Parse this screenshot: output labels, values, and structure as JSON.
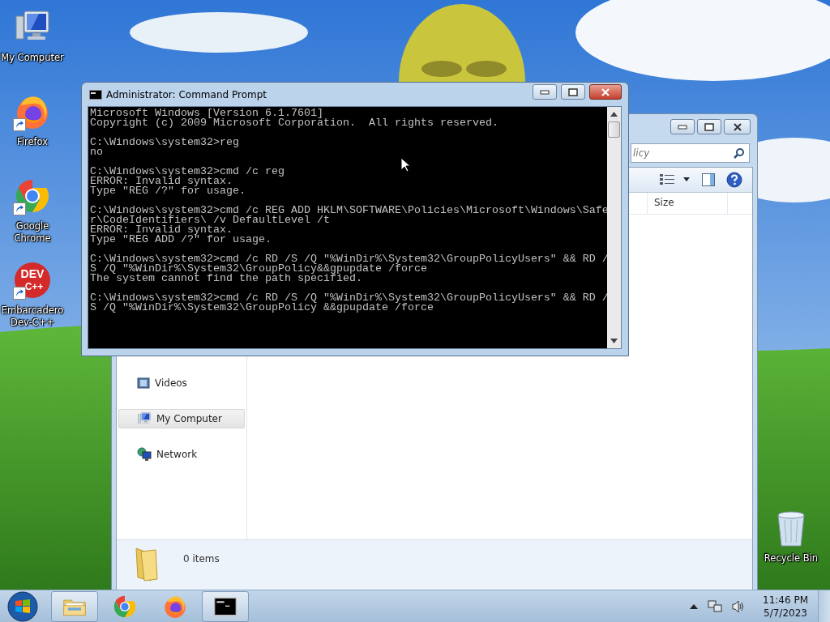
{
  "desktop_icons": [
    {
      "label": "My Computer",
      "kind": "computer",
      "shortcut": false
    },
    {
      "label": "Firefox",
      "kind": "firefox",
      "shortcut": true
    },
    {
      "label": "Google Chrome",
      "kind": "chrome",
      "shortcut": true
    },
    {
      "label": "Embarcadero Dev-C++",
      "kind": "devcpp",
      "shortcut": true,
      "logo_lines": [
        "DEV",
        "C++"
      ]
    }
  ],
  "recycle_bin": {
    "label": "Recycle Bin"
  },
  "explorer_window": {
    "search": {
      "placeholder": "licy"
    },
    "columns": [
      "Size"
    ],
    "nav_items": [
      {
        "label": "Videos",
        "kind": "videos",
        "selected": false
      },
      {
        "label": "My Computer",
        "kind": "computer",
        "selected": true
      },
      {
        "label": "Network",
        "kind": "network",
        "selected": false
      }
    ],
    "status_bar": "0 items"
  },
  "cmd_window": {
    "title": "Administrator:  Command Prompt",
    "blocks": [
      [
        "Microsoft Windows [Version 6.1.7601]",
        "Copyright (c) 2009 Microsoft Corporation.  All rights reserved."
      ],
      [
        "C:\\Windows\\system32>reg",
        "no"
      ],
      [
        "C:\\Windows\\system32>cmd /c reg",
        "ERROR: Invalid syntax.",
        "Type \"REG /?\" for usage."
      ],
      [
        "C:\\Windows\\system32>cmd /c REG ADD HKLM\\SOFTWARE\\Policies\\Microsoft\\Windows\\Safe",
        "r\\CodeIdentifiers\\ /v DefaultLevel /t",
        "ERROR: Invalid syntax.",
        "Type \"REG ADD /?\" for usage."
      ],
      [
        "C:\\Windows\\system32>cmd /c RD /S /Q \"%WinDir%\\System32\\GroupPolicyUsers\" && RD /",
        "S /Q \"%WinDir%\\System32\\GroupPolicy&&gpupdate /force",
        "The system cannot find the path specified."
      ],
      [
        "C:\\Windows\\system32>cmd /c RD /S /Q \"%WinDir%\\System32\\GroupPolicyUsers\" && RD /",
        "S /Q \"%WinDir%\\System32\\GroupPolicy &&gpupdate /force"
      ]
    ]
  },
  "taskbar": {
    "items": [
      {
        "kind": "explorer",
        "active": true
      },
      {
        "kind": "chrome",
        "active": false
      },
      {
        "kind": "firefox",
        "active": false
      },
      {
        "kind": "cmd",
        "active": true
      }
    ],
    "clock": {
      "time": "11:46 PM",
      "date": "5/7/2023"
    }
  }
}
